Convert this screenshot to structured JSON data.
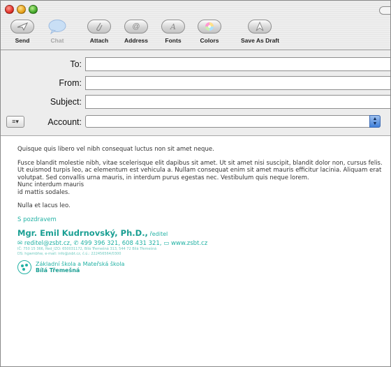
{
  "toolbar": {
    "items": [
      {
        "label": "Send",
        "icon": "paper-plane-icon"
      },
      {
        "label": "Chat",
        "icon": "speech-bubble-icon"
      },
      {
        "label": "Attach",
        "icon": "paperclip-icon"
      },
      {
        "label": "Address",
        "icon": "at-sign-icon"
      },
      {
        "label": "Fonts",
        "icon": "letter-a-icon"
      },
      {
        "label": "Colors",
        "icon": "color-wheel-icon"
      },
      {
        "label": "Save As Draft",
        "icon": "draft-icon"
      }
    ]
  },
  "headers": {
    "to_label": "To:",
    "from_label": "From:",
    "subject_label": "Subject:",
    "account_label": "Account:",
    "to_value": "",
    "from_value": "",
    "subject_value": "",
    "account_value": ""
  },
  "message": {
    "p1": "Quisque quis libero vel nibh consequat luctus non sit amet neque.",
    "p2a": "Fusce blandit molestie nibh, vitae scelerisque elit dapibus sit amet. Ut sit amet nisi suscipit, blandit dolor non, cursus felis. Ut euismod turpis leo, ac elementum est vehicula a. Nullam consequat enim sit amet mauris efficitur lacinia. Aliquam erat volutpat. Sed convallis urna mauris, in interdum purus egestas nec. Vestibulum quis neque lorem.",
    "p2b": "Nunc interdum mauris",
    "p2c": "id mattis sodales.",
    "p3": "Nulla et lacus leo.",
    "greeting": "S pozdravem",
    "sig_name": "Mgr. Emil Kudrnovský, Ph.D.,",
    "sig_role": "ředitel",
    "email": "reditel@zsbt.cz,",
    "phone": "499 396 321, 608 431 321,",
    "web": "www.zsbt.cz",
    "tiny1": "IČ: 750 15 366, Red_IZO: 650031172, Bílá Třemešná 313, 544 72 Bílá Třemešná",
    "tiny2": "DS: hgwmbhw, e-mail: info@zsbt.cz, č.ú.: 222456564/0300",
    "school_line1": "Základní škola a Mateřská škola",
    "school_line2": "Bílá Třemešná"
  },
  "colors": {
    "accent_teal": "#22b2a4",
    "select_blue": "#3f7fd9"
  }
}
